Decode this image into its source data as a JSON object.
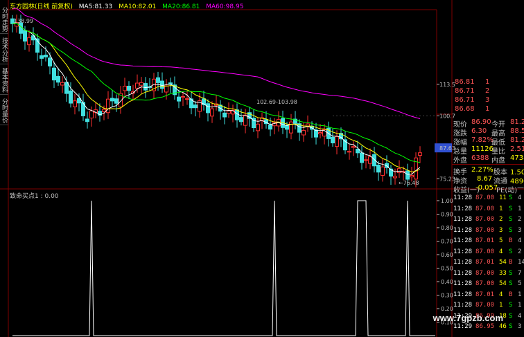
{
  "app": {
    "side_tabs": [
      "分时走势",
      "技术分析",
      "基本资料",
      "分时量价"
    ],
    "stock_title": "东方园林(日线 前复权)",
    "ma": [
      {
        "name": "MA5",
        "value": "81.33",
        "color": "#ffffff"
      },
      {
        "name": "MA10",
        "value": "82.01",
        "color": "#ffff00"
      },
      {
        "name": "MA20",
        "value": "86.81",
        "color": "#00ff00"
      },
      {
        "name": "MA60",
        "value": "98.95",
        "color": "#ff00ff"
      }
    ],
    "indicator_title": "致命买点1 : 0.00",
    "watermark": "www.7gpzb.com"
  },
  "chart_data": {
    "type": "candlestick",
    "price_axis": {
      "ticks": [
        "113.5",
        "100.7",
        "87.63",
        "75.23"
      ],
      "current": "87.63"
    },
    "annotations": {
      "high_label": "138.99",
      "mid_label": "102.69-103.98",
      "low_label": "←76.48"
    },
    "indicator_axis": {
      "ticks": [
        "1.00",
        "0.90",
        "0.80",
        "0.70",
        "0.60",
        "0.50",
        "0.40",
        "0.30",
        "0.20",
        "0.10"
      ]
    },
    "indicator_spikes": [
      {
        "from": 19,
        "to": 19
      },
      {
        "from": 63,
        "to": 63
      },
      {
        "from": 83,
        "to": 85
      },
      {
        "from": 95,
        "to": 95
      }
    ],
    "candles_count": 99
  },
  "quote": {
    "ask": [
      {
        "label": "86.81",
        "vol": "1"
      },
      {
        "label": "86.71",
        "vol": "2"
      },
      {
        "label": "86.71",
        "vol": "3"
      },
      {
        "label": "86.68",
        "vol": "1"
      }
    ],
    "rows": [
      {
        "l1": "现价",
        "v1": "86.90",
        "l2": "今开",
        "v2": "81.20"
      },
      {
        "l1": "涨跌",
        "v1": "6.30",
        "l2": "最高",
        "v2": "88.50"
      },
      {
        "l1": "涨幅",
        "v1": "7.82%",
        "l2": "最低",
        "v2": "81.20"
      },
      {
        "l1": "总量",
        "v1": "11126",
        "l2": "量比",
        "v2": "2.51"
      },
      {
        "l1": "外盘",
        "v1": "6388",
        "l2": "内盘",
        "v2": "4738"
      },
      {
        "l1": "换手",
        "v1": "2.27%",
        "l2": "股本",
        "v2": "1.50亿"
      },
      {
        "l1": "净资",
        "v1": "8.67",
        "l2": "流通",
        "v2": "4890万"
      },
      {
        "l1": "收益(一)",
        "v1": "-0.057",
        "l2": "PE(动)",
        "v2": "—"
      }
    ],
    "trades": [
      {
        "time": "11:28",
        "price": "87.00",
        "vol": "11",
        "side": "S",
        "n": "4"
      },
      {
        "time": "11:28",
        "price": "87.00",
        "vol": "1",
        "side": "S",
        "n": "1"
      },
      {
        "time": "11:28",
        "price": "87.00",
        "vol": "2",
        "side": "S",
        "n": "2"
      },
      {
        "time": "11:28",
        "price": "87.00",
        "vol": "3",
        "side": "S",
        "n": "3"
      },
      {
        "time": "11:28",
        "price": "87.01",
        "vol": "5",
        "side": "B",
        "n": "4"
      },
      {
        "time": "11:28",
        "price": "87.00",
        "vol": "4",
        "side": "S",
        "n": "2"
      },
      {
        "time": "11:28",
        "price": "87.01",
        "vol": "54",
        "side": "B",
        "n": "14"
      },
      {
        "time": "11:28",
        "price": "87.00",
        "vol": "33",
        "side": "S",
        "n": "7"
      },
      {
        "time": "11:28",
        "price": "87.00",
        "vol": "54",
        "side": "S",
        "n": "5"
      },
      {
        "time": "11:28",
        "price": "87.01",
        "vol": "4",
        "side": "B",
        "n": "1"
      },
      {
        "time": "11:28",
        "price": "87.00",
        "vol": "1",
        "side": "S",
        "n": "1"
      },
      {
        "time": "11:29",
        "price": "86.99",
        "vol": "18",
        "side": "S",
        "n": "4"
      },
      {
        "time": "11:29",
        "price": "86.95",
        "vol": "46",
        "side": "S",
        "n": "3"
      }
    ]
  }
}
